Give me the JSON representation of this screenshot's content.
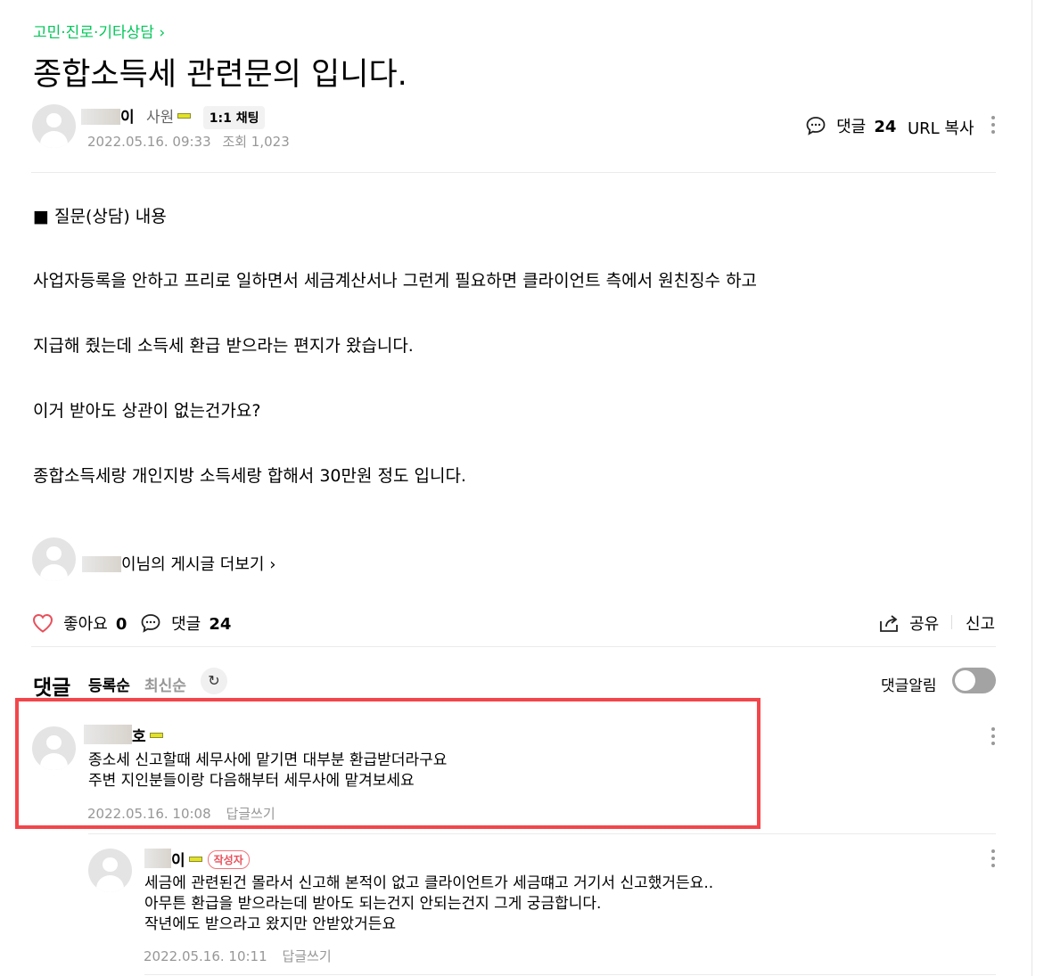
{
  "post": {
    "category": "고민·진로·기타상담 ›",
    "title": "종합소득세 관련문의 입니다.",
    "author_suffix": "이",
    "author_role": "사원",
    "chat_badge": "1:1 채팅",
    "date": "2022.05.16. 09:33",
    "views": "조회 1,023",
    "comment_label": "댓글",
    "comment_count": "24",
    "url_copy": "URL 복사",
    "body": [
      "■  질문(상담) 내용",
      "사업자등록을 안하고 프리로 일하면서 세금계산서나 그런게 필요하면 클라이언트 측에서 원친징수 하고",
      "지급해 줬는데 소득세 환급 받으라는 편지가 왔습니다.",
      "이거 받아도 상관이 없는건가요?",
      "종합소득세랑 개인지방 소득세랑 합해서 30만원 정도 입니다."
    ],
    "more_posts": "이님의 게시글 더보기 ›"
  },
  "actions": {
    "like_label": "좋아요",
    "like_count": "0",
    "comment_label": "댓글",
    "comment_count": "24",
    "share": "공유",
    "report": "신고"
  },
  "comments_section": {
    "heading": "댓글",
    "sort_registered": "등록순",
    "sort_latest": "최신순",
    "notify_label": "댓글알림",
    "notify_on": false
  },
  "comments": [
    {
      "author_suffix": "호",
      "lines": [
        "종소세 신고할때 세무사에 맡기면 대부분 환급받더라구요",
        "주변 지인분들이랑 다음해부터 세무사에 맡겨보세요"
      ],
      "date": "2022.05.16. 10:08",
      "reply": "답글쓰기"
    },
    {
      "author_suffix": "이",
      "author_badge": "작성자",
      "lines": [
        "세금에 관련된건 몰라서 신고해 본적이 없고 클라이언트가 세금떄고 거기서 신고했거든요..",
        "아무튼 환급을 받으라는데 받아도 되는건지 안되는건지 그게 궁금합니다.",
        "작년에도 받으라고 왔지만 안받았거든요"
      ],
      "date": "2022.05.16. 10:11",
      "reply": "답글쓰기"
    }
  ],
  "colors": {
    "accent_green": "#03c75a",
    "highlight_red": "#f2464b",
    "like_heart": "#e8505b"
  }
}
